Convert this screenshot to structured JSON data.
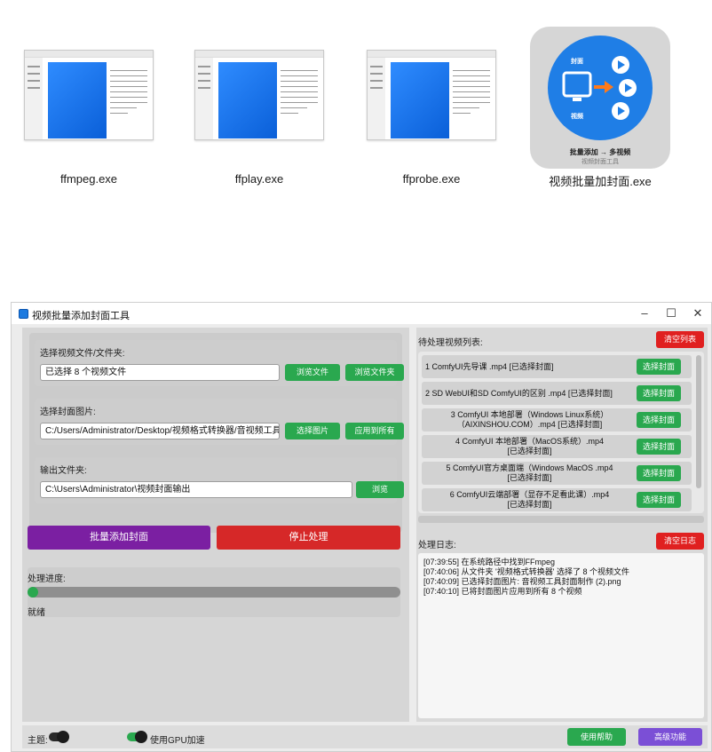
{
  "desktop": {
    "icons": [
      {
        "label": "ffmpeg.exe"
      },
      {
        "label": "ffplay.exe"
      },
      {
        "label": "ffprobe.exe"
      },
      {
        "label": "视频批量加封面.exe",
        "app_caption_1": "批量添加 → 多视频",
        "app_caption_2": "视频封面工具",
        "badge_top": "封面",
        "badge_bottom": "视频"
      }
    ]
  },
  "window": {
    "title": "视频批量添加封面工具",
    "controls": {
      "minimize": "–",
      "maximize": "☐",
      "close": "✕"
    }
  },
  "input": {
    "video_label": "选择视频文件/文件夹:",
    "video_value": "已选择 8 个视频文件",
    "browse_file": "浏览文件",
    "browse_folder": "浏览文件夹",
    "cover_label": "选择封面图片:",
    "cover_value": "C:/Users/Administrator/Desktop/视频格式转换器/音视频工具封面制",
    "select_image": "选择图片",
    "apply_all": "应用到所有",
    "output_label": "输出文件夹:",
    "output_value": "C:\\Users\\Administrator\\视频封面输出",
    "browse": "浏览"
  },
  "actions": {
    "start": "批量添加封面",
    "stop": "停止处理",
    "start_color": "#7b1fa2",
    "stop_color": "#d62828"
  },
  "progress": {
    "label": "处理进度:",
    "value": 0,
    "status": "就绪"
  },
  "queue": {
    "label": "待处理视频列表:",
    "clear_button": "清空列表",
    "items": [
      {
        "text": "1 ComfyUI先导课 .mp4 [已选择封面]",
        "button": "选择封面"
      },
      {
        "text": "2 SD WebUI和SD ComfyUI的区别 .mp4 [已选择封面]",
        "button": "选择封面"
      },
      {
        "text": "3 ComfyUI 本地部署（Windows Linux系统）\n（AIXINSHOU.COM）.mp4 [已选择封面]",
        "button": "选择封面"
      },
      {
        "text": "4 ComfyUI 本地部署（MacOS系统）.mp4\n[已选择封面]",
        "button": "选择封面"
      },
      {
        "text": "5 ComfyUI官方桌面端（Windows MacOS .mp4\n[已选择封面]",
        "button": "选择封面"
      },
      {
        "text": "6 ComfyUI云端部署（显存不足看此课）.mp4\n[已选择封面]",
        "button": "选择封面"
      }
    ]
  },
  "log": {
    "label": "处理日志:",
    "clear_button": "清空日志",
    "lines": [
      "[07:39:55] 在系统路径中找到FFmpeg",
      "[07:40:06] 从文件夹 '视频格式转换器' 选择了 8 个视频文件",
      "[07:40:09] 已选择封面图片: 音视频工具封面制作 (2).png",
      "[07:40:10] 已将封面图片应用到所有 8 个视频"
    ]
  },
  "footer": {
    "theme_label": "主题:",
    "gpu_label": "使用GPU加速",
    "help_button": "使用帮助",
    "advanced_button": "高级功能",
    "help_color": "#2aa84f",
    "advanced_color": "#7b4fd6"
  }
}
